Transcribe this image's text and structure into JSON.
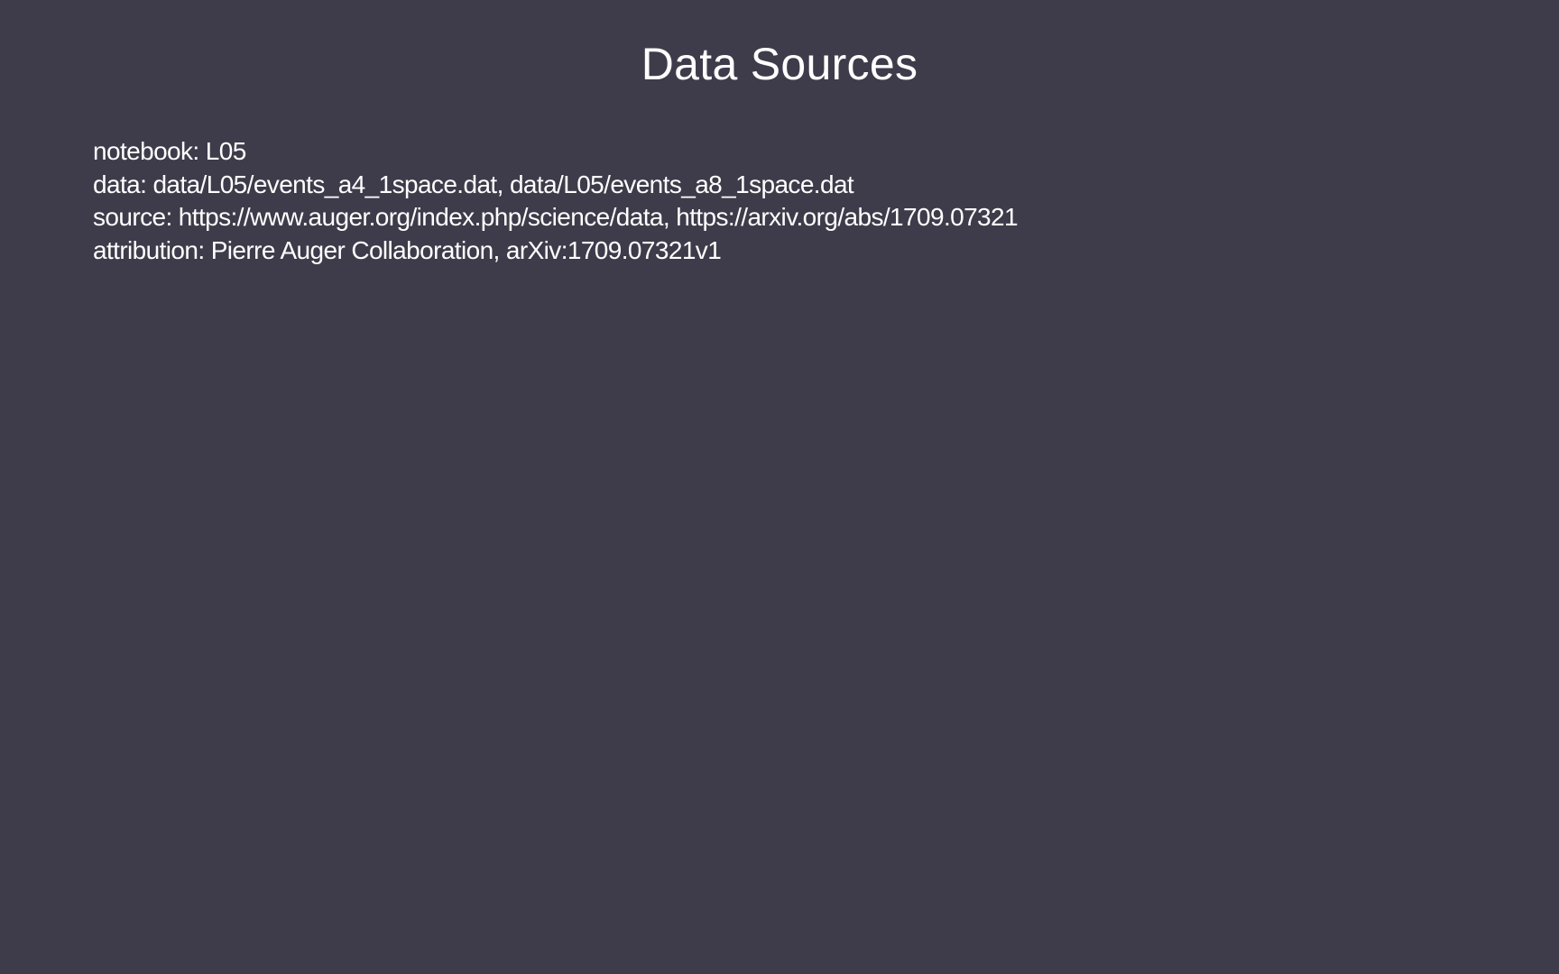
{
  "slide": {
    "title": "Data Sources",
    "lines": [
      "notebook: L05",
      "data: data/L05/events_a4_1space.dat, data/L05/events_a8_1space.dat",
      "source: https://www.auger.org/index.php/science/data, https://arxiv.org/abs/1709.07321",
      "attribution: Pierre Auger Collaboration, arXiv:1709.07321v1"
    ]
  },
  "colors": {
    "background": "#3e3c4a",
    "text": "#ffffff"
  }
}
